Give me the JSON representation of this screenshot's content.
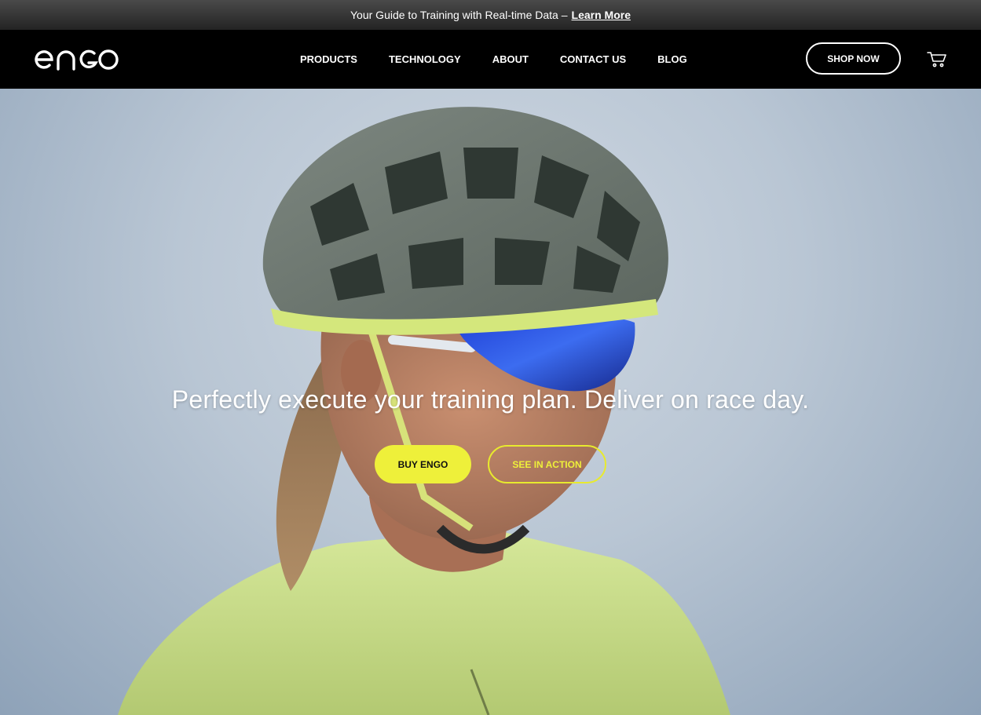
{
  "announcement": {
    "text": "Your Guide to Training with Real-time Data –",
    "link_label": "Learn More"
  },
  "header": {
    "logo_text": "engo",
    "nav": [
      {
        "label": "PRODUCTS"
      },
      {
        "label": "TECHNOLOGY"
      },
      {
        "label": "ABOUT"
      },
      {
        "label": "CONTACT US"
      },
      {
        "label": "BLOG"
      }
    ],
    "shop_label": "SHOP NOW",
    "cart_icon": "cart-icon"
  },
  "hero": {
    "headline": "Perfectly execute your training plan. Deliver on race day.",
    "primary_cta": "BUY ENGO",
    "secondary_cta": "SEE IN ACTION",
    "image": "cyclist-helmet-sunglasses"
  },
  "colors": {
    "accent": "#eef03a",
    "header_bg": "#000000",
    "text": "#ffffff"
  }
}
